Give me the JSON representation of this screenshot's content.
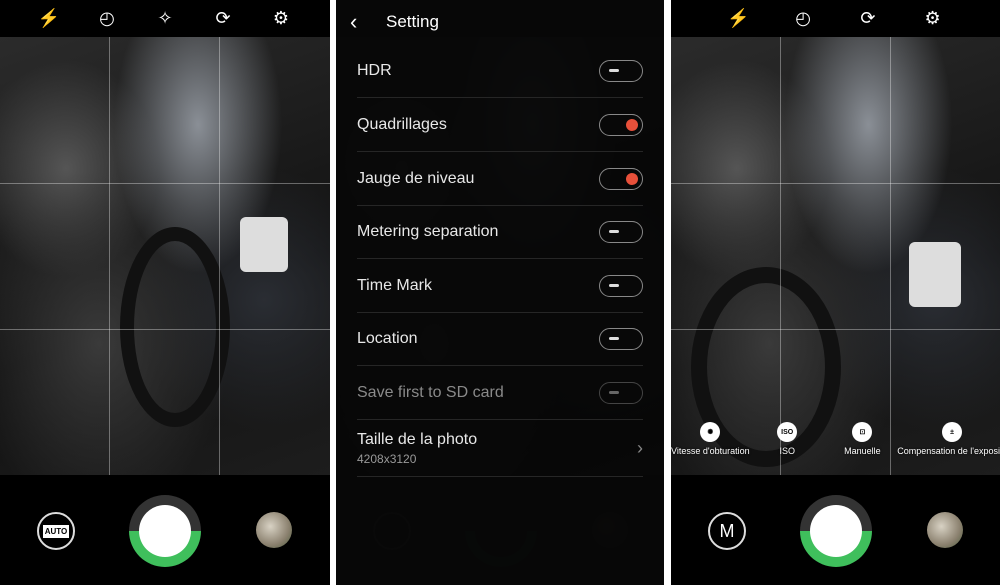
{
  "camera_left": {
    "top_icons": [
      "flash-off-icon",
      "timer-icon",
      "magic-wand-icon",
      "switch-camera-icon",
      "gear-icon"
    ],
    "mode_badge": "AUTO"
  },
  "settings": {
    "title": "Setting",
    "rows": [
      {
        "label": "HDR",
        "state": "off"
      },
      {
        "label": "Quadrillages",
        "state": "on"
      },
      {
        "label": "Jauge de niveau",
        "state": "on"
      },
      {
        "label": "Metering separation",
        "state": "off"
      },
      {
        "label": "Time Mark",
        "state": "off"
      },
      {
        "label": "Location",
        "state": "off"
      },
      {
        "label": "Save first to SD card",
        "state": "disabled"
      },
      {
        "label": "Taille de la photo",
        "value": "4208x3120"
      }
    ],
    "accent": "#e8503a"
  },
  "camera_right": {
    "top_icons": [
      "flash-off-icon",
      "timer-icon",
      "switch-camera-icon",
      "gear-icon"
    ],
    "mode_badge": "M",
    "manual_controls": [
      {
        "label": "Vitesse d'obturation",
        "icon": "aperture-icon"
      },
      {
        "label": "ISO",
        "icon": "ISO"
      },
      {
        "label": "Manuelle",
        "icon": "focus-icon"
      },
      {
        "label": "Compensation de l'exposi",
        "icon": "exposure-icon"
      }
    ]
  },
  "colors": {
    "shutter_ring": "#3fbf5c"
  }
}
